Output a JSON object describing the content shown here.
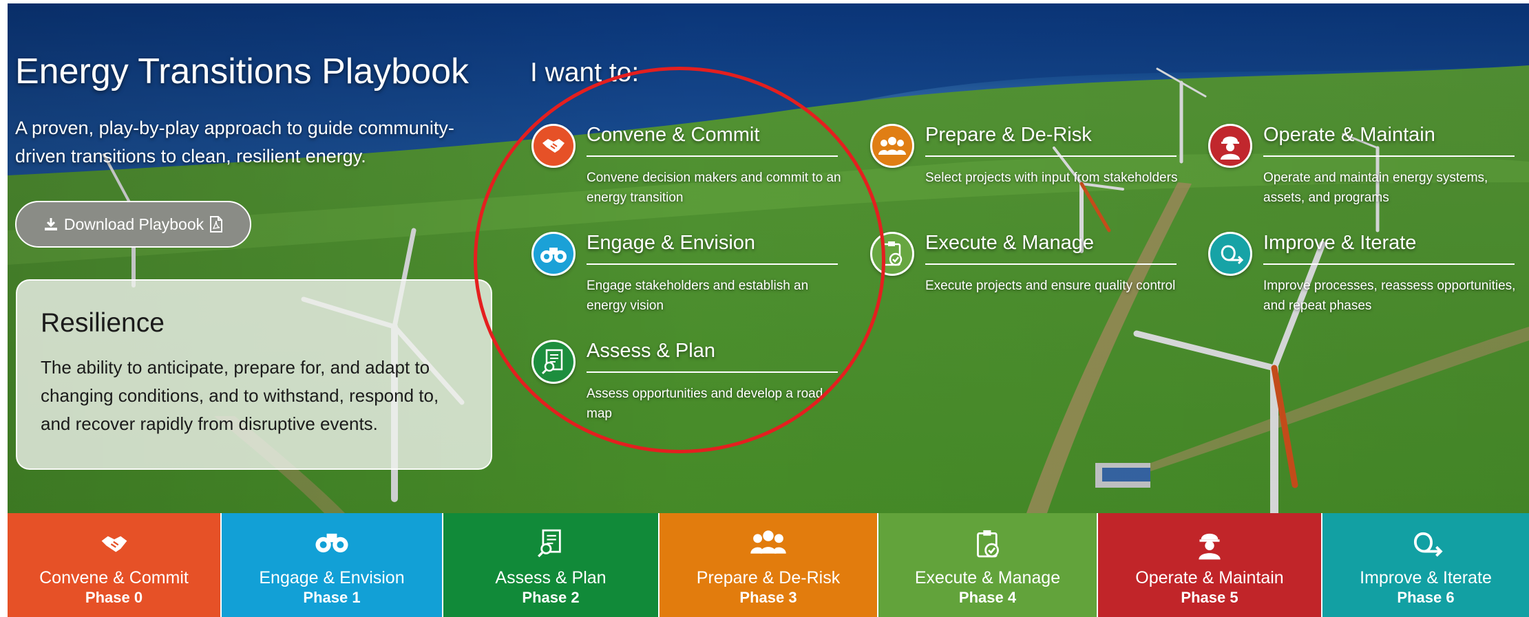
{
  "page": {
    "title": "Energy Transitions Playbook",
    "tagline": "A proven, play-by-play approach to guide community-driven transitions to clean, resilient energy.",
    "download_label": "Download Playbook",
    "download_icons": [
      "download-icon",
      "pdf-icon"
    ]
  },
  "definition": {
    "term": "Resilience",
    "text": "The ability to anticipate, prepare for, and adapt to changing conditions, and to withstand, respond to, and recover rapidly from disruptive events."
  },
  "chooser": {
    "heading": "I want to:",
    "phases": [
      {
        "title": "Convene & Commit",
        "desc": "Convene decision makers and commit to an energy transition",
        "icon": "handshake-icon",
        "color": "#e65127"
      },
      {
        "title": "Engage & Envision",
        "desc": "Engage stakeholders and establish an energy vision",
        "icon": "binoculars-icon",
        "color": "#1ba1d7"
      },
      {
        "title": "Assess & Plan",
        "desc": "Assess opportunities and develop a road map",
        "icon": "document-search-icon",
        "color": "#1d8e3e"
      },
      {
        "title": "Prepare & De-Risk",
        "desc": "Select projects with input from stakeholders",
        "icon": "people-group-icon",
        "color": "#e07e14"
      },
      {
        "title": "Execute & Manage",
        "desc": "Execute projects and ensure quality control",
        "icon": "clipboard-check-icon",
        "color": "#67a641"
      },
      {
        "title": "Operate & Maintain",
        "desc": "Operate and maintain energy systems, assets, and programs",
        "icon": "hardhat-worker-icon",
        "color": "#c1272d"
      },
      {
        "title": "Improve & Iterate",
        "desc": "Improve processes, reassess opportunities, and repeat phases",
        "icon": "loop-arrow-icon",
        "color": "#17a3a6"
      }
    ]
  },
  "phasebar": [
    {
      "label": "Convene & Commit",
      "phase": "Phase 0",
      "color": "#e65127",
      "icon": "handshake-icon"
    },
    {
      "label": "Engage & Envision",
      "phase": "Phase 1",
      "color": "#12a0d6",
      "icon": "binoculars-icon"
    },
    {
      "label": "Assess & Plan",
      "phase": "Phase 2",
      "color": "#118a39",
      "icon": "document-search-icon"
    },
    {
      "label": "Prepare & De-Risk",
      "phase": "Phase 3",
      "color": "#e27c0d",
      "icon": "people-group-icon"
    },
    {
      "label": "Execute & Manage",
      "phase": "Phase 4",
      "color": "#62a33b",
      "icon": "clipboard-check-icon"
    },
    {
      "label": "Operate & Maintain",
      "phase": "Phase 5",
      "color": "#c12529",
      "icon": "hardhat-worker-icon"
    },
    {
      "label": "Improve & Iterate",
      "phase": "Phase 6",
      "color": "#12a0a3",
      "icon": "loop-arrow-icon"
    }
  ]
}
